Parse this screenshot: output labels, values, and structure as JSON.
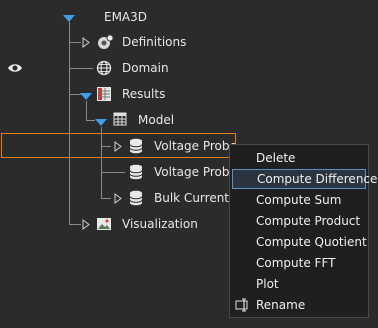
{
  "tree": {
    "root": {
      "label": "EMA3D",
      "icon": "expanded-triangle-icon"
    },
    "nodes": [
      {
        "label": "Definitions",
        "icon": "definitions-icon"
      },
      {
        "label": "Domain",
        "icon": "globe-icon"
      },
      {
        "label": "Results",
        "icon": "results-table-icon"
      },
      {
        "label": "Model",
        "icon": "model-grid-icon"
      },
      {
        "label": "Voltage Probe",
        "icon": "database-icon"
      },
      {
        "label": "Voltage Probe",
        "icon": "database-icon"
      },
      {
        "label": "Bulk Current",
        "icon": "database-icon"
      },
      {
        "label": "Visualization",
        "icon": "visualization-icon"
      }
    ],
    "visibility_icon": "eye-icon"
  },
  "context_menu": {
    "items": [
      {
        "label": "Delete"
      },
      {
        "label": "Compute Difference",
        "active": true
      },
      {
        "label": "Compute Sum"
      },
      {
        "label": "Compute Product"
      },
      {
        "label": "Compute Quotient"
      },
      {
        "label": "Compute FFT"
      },
      {
        "label": "Plot"
      },
      {
        "label": "Rename",
        "icon": "rename-icon"
      }
    ]
  },
  "colors": {
    "background": "#2b2b2b",
    "selection_border": "#e07d1a",
    "menu_background": "#1f1f1f",
    "menu_active_border": "#5a90c8",
    "expand_triangle": "#3aa0e8"
  }
}
